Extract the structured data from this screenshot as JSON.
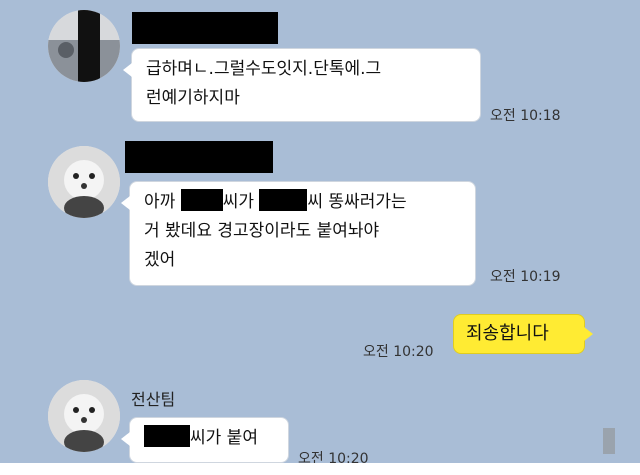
{
  "messages": [
    {
      "lines": [
        "급하며ㄴ.그럴수도잇지.단톡에.그",
        "런예기하지마"
      ],
      "time": "오전 10:18"
    },
    {
      "parts": {
        "line1_a": "아까",
        "line1_b": "씨가",
        "line1_c": "씨 똥싸러가는",
        "line2": "거 봤데요 경고장이라도 붙여놔야",
        "line3": "겠어"
      },
      "time": "오전 10:19"
    },
    {
      "text": "죄송합니다",
      "time": "오전 10:20"
    },
    {
      "sender": "전산팀",
      "text": "씨가 붙여",
      "time": "오전 10:20"
    }
  ],
  "colors": {
    "chat_background": "#a9bdd6",
    "my_bubble": "#ffeb33",
    "their_bubble": "#ffffff"
  }
}
